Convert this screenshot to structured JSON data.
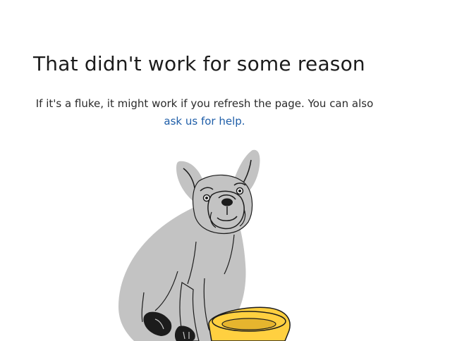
{
  "error": {
    "title": "That didn't work for some reason",
    "message": "If it's a fluke, it might work if you refresh the page. You can also",
    "help_link": "ask us for help."
  },
  "illustration": {
    "icon": "sad-french-bulldog-with-bowl",
    "colors": {
      "dog_body": "#c3c3c3",
      "outline": "#1c1c1c",
      "bowl": "#ffd040"
    }
  },
  "colors": {
    "background": "#ffffff",
    "text": "#1c1c1c",
    "link": "#1f5ea8"
  }
}
